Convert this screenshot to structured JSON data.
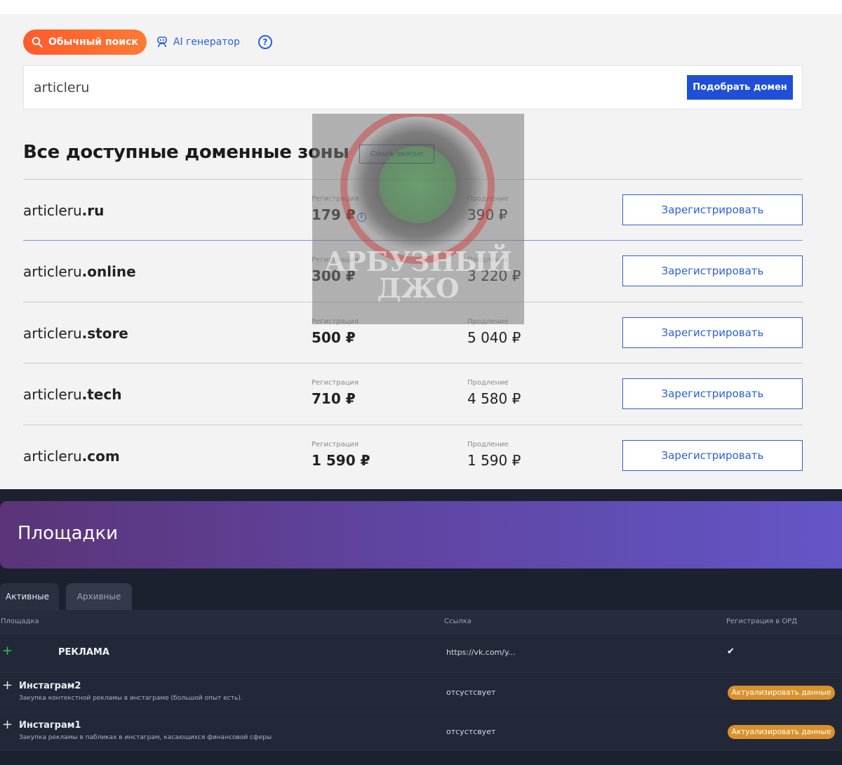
{
  "search": {
    "tab_normal": "Обычный поиск",
    "tab_ai": "AI генератор",
    "help": "?",
    "query": "articleru",
    "submit": "Подобрать домен"
  },
  "zones": {
    "title": "Все доступные доменные зоны",
    "hide_taken": "Скрыть занятые",
    "reg_label": "Регистрация",
    "renew_label": "Продление",
    "register_label": "Зарегистрировать",
    "rows": [
      {
        "base": "articleru",
        "tld": ".ru",
        "reg": "179 ₽",
        "renew": "390 ₽"
      },
      {
        "base": "articleru",
        "tld": ".online",
        "reg": "300 ₽",
        "renew": "3 220 ₽"
      },
      {
        "base": "articleru",
        "tld": ".store",
        "reg": "500 ₽",
        "renew": "5 040 ₽"
      },
      {
        "base": "articleru",
        "tld": ".tech",
        "reg": "710 ₽",
        "renew": "4 580 ₽"
      },
      {
        "base": "articleru",
        "tld": ".com",
        "reg": "1 590 ₽",
        "renew": "1 590 ₽"
      }
    ]
  },
  "watermark": {
    "line1": "АРБУЗНЫЙ",
    "line2": "ДЖО"
  },
  "placements": {
    "title": "Площадки",
    "tabs": [
      "Активные",
      "Архивные"
    ],
    "columns": [
      "Площадка",
      "Ссылка",
      "Регистрация в ОРД"
    ],
    "rows": [
      {
        "name": "РЕКЛАМА",
        "desc": "",
        "link": "https://vk.com/y...",
        "ord": "✔"
      },
      {
        "name": "Инстаграм2",
        "desc": "Закупка контекстной рекламы в инстаграме (большой опыт есть).",
        "link": "отсустсвует",
        "ord": "Актуализировать данные"
      },
      {
        "name": "Инстаграм1",
        "desc": "Закупка рекламы в пабликах в инстаграм, касающихся финансовой сферы",
        "link": "отсустсвует",
        "ord": "Актуализировать данные"
      }
    ]
  }
}
